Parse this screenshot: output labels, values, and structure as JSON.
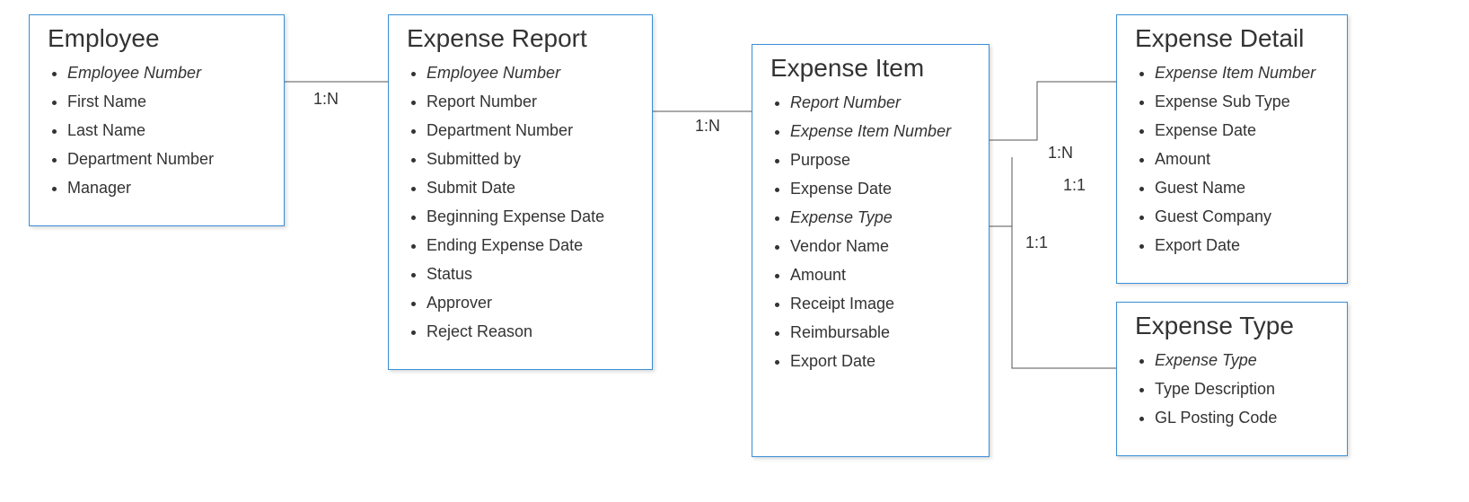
{
  "entities": {
    "employee": {
      "title": "Employee",
      "attributes": [
        {
          "label": "Employee Number",
          "key": true
        },
        {
          "label": "First Name",
          "key": false
        },
        {
          "label": "Last Name",
          "key": false
        },
        {
          "label": "Department Number",
          "key": false
        },
        {
          "label": "Manager",
          "key": false
        }
      ]
    },
    "expense_report": {
      "title": "Expense Report",
      "attributes": [
        {
          "label": "Employee Number",
          "key": true
        },
        {
          "label": "Report Number",
          "key": false
        },
        {
          "label": "Department Number",
          "key": false
        },
        {
          "label": "Submitted by",
          "key": false
        },
        {
          "label": "Submit Date",
          "key": false
        },
        {
          "label": "Beginning Expense Date",
          "key": false
        },
        {
          "label": "Ending Expense Date",
          "key": false
        },
        {
          "label": "Status",
          "key": false
        },
        {
          "label": "Approver",
          "key": false
        },
        {
          "label": "Reject Reason",
          "key": false
        }
      ]
    },
    "expense_item": {
      "title": "Expense Item",
      "attributes": [
        {
          "label": "Report Number",
          "key": true
        },
        {
          "label": "Expense Item Number",
          "key": true
        },
        {
          "label": "Purpose",
          "key": false
        },
        {
          "label": "Expense Date",
          "key": false
        },
        {
          "label": "Expense Type",
          "key": true
        },
        {
          "label": "Vendor Name",
          "key": false
        },
        {
          "label": "Amount",
          "key": false
        },
        {
          "label": "Receipt Image",
          "key": false
        },
        {
          "label": "Reimbursable",
          "key": false
        },
        {
          "label": "Export Date",
          "key": false
        }
      ]
    },
    "expense_detail": {
      "title": "Expense Detail",
      "attributes": [
        {
          "label": "Expense Item Number",
          "key": true
        },
        {
          "label": "Expense Sub Type",
          "key": false
        },
        {
          "label": "Expense Date",
          "key": false
        },
        {
          "label": "Amount",
          "key": false
        },
        {
          "label": "Guest Name",
          "key": false
        },
        {
          "label": "Guest Company",
          "key": false
        },
        {
          "label": "Export Date",
          "key": false
        }
      ]
    },
    "expense_type": {
      "title": "Expense Type",
      "attributes": [
        {
          "label": "Expense Type",
          "key": true
        },
        {
          "label": "Type Description",
          "key": false
        },
        {
          "label": "GL Posting Code",
          "key": false
        }
      ]
    }
  },
  "relationships": {
    "emp_to_report": "1:N",
    "report_to_item": "1:N",
    "item_to_detail": "1:N",
    "item_to_type_upper": "1:1",
    "item_to_type_lower": "1:1"
  }
}
